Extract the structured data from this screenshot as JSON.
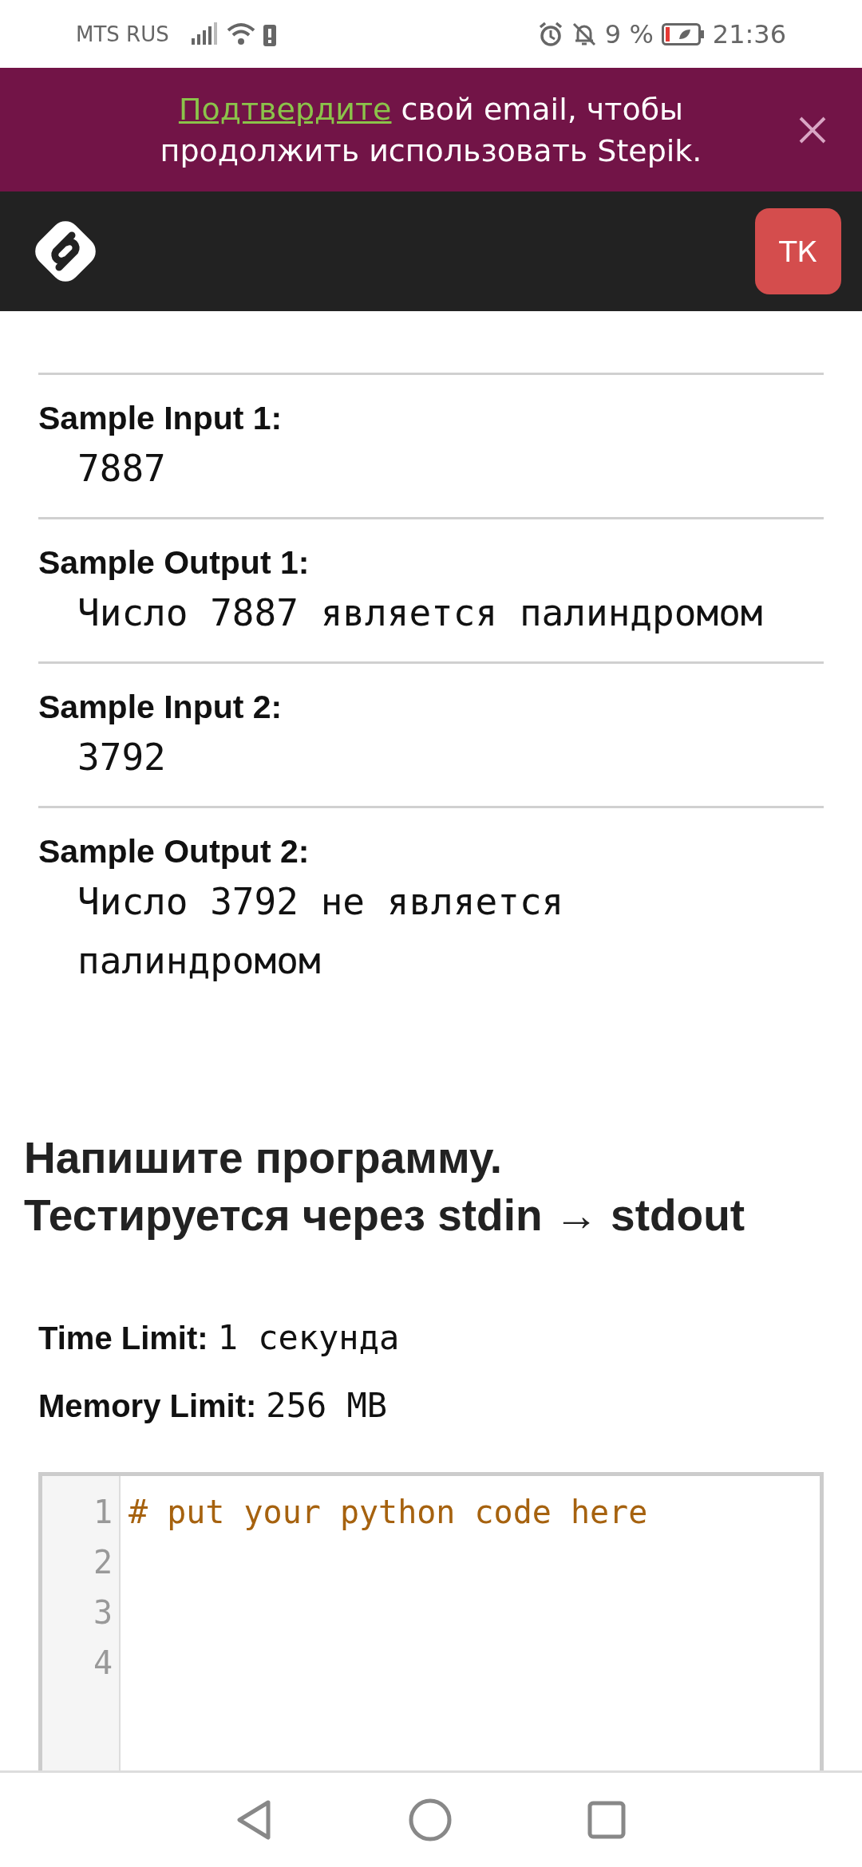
{
  "status_bar": {
    "carrier": "MTS RUS",
    "battery_percent": "9 %",
    "time": "21:36"
  },
  "banner": {
    "link": "Подтвердите",
    "message": " свой email, чтобы продолжить использовать Stepik."
  },
  "header": {
    "avatar_initials": "ТК"
  },
  "samples": [
    {
      "label": "Sample Input 1:",
      "value": "7887"
    },
    {
      "label": "Sample Output 1:",
      "value": "Число 7887 является палиндромом"
    },
    {
      "label": "Sample Input 2:",
      "value": "3792"
    },
    {
      "label": "Sample Output 2:",
      "value": "Число 3792 не является палиндромом"
    }
  ],
  "task_heading": [
    "Напишите программу.",
    "Тестируется через stdin → stdout"
  ],
  "limits": [
    {
      "label": "Time Limit:",
      "value": "1 секунда"
    },
    {
      "label": "Memory Limit:",
      "value": "256 MB"
    }
  ],
  "editor": {
    "lines": [
      {
        "number": "1",
        "code": "# put your python code here"
      },
      {
        "number": "2"
      },
      {
        "number": "3"
      },
      {
        "number": "4"
      }
    ]
  }
}
